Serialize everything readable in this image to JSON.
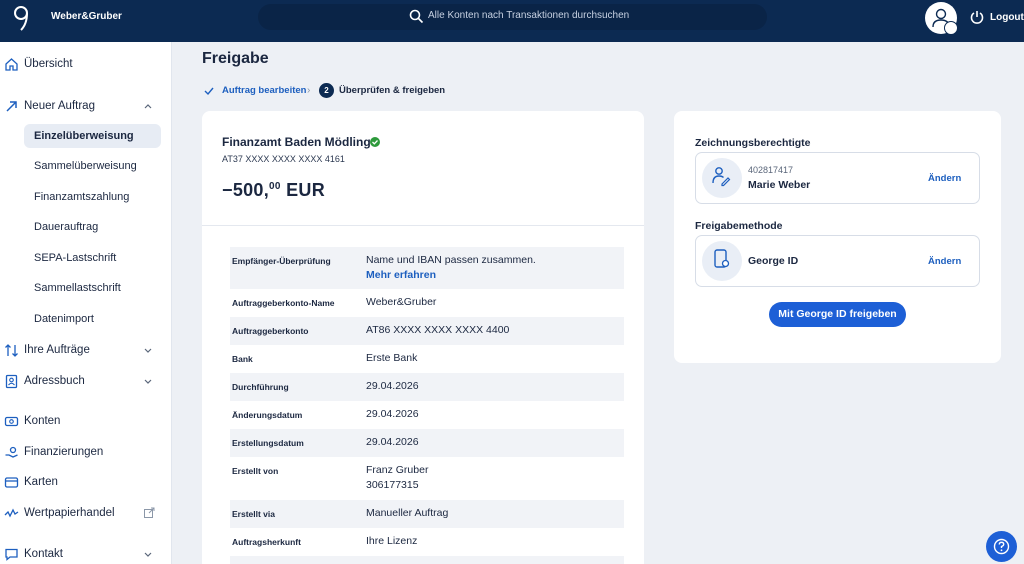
{
  "header": {
    "brand": "Weber&Gruber",
    "search_placeholder": "Alle Konten nach Transaktionen durchsuchen",
    "logout_label": "Logout"
  },
  "sidebar": {
    "items": [
      {
        "label": "Übersicht",
        "icon": "home-icon"
      },
      {
        "label": "Neuer Auftrag",
        "icon": "arrow-up-right-icon",
        "expanded": true
      },
      {
        "label": "Ihre Aufträge",
        "icon": "transfer-arrows-icon"
      },
      {
        "label": "Adressbuch",
        "icon": "address-book-icon"
      },
      {
        "label": "Konten",
        "icon": "accounts-icon"
      },
      {
        "label": "Finanzierungen",
        "icon": "financing-icon"
      },
      {
        "label": "Karten",
        "icon": "card-icon"
      },
      {
        "label": "Wertpapierhandel",
        "icon": "chart-icon"
      },
      {
        "label": "Kontakt",
        "icon": "chat-icon"
      }
    ],
    "subitems": [
      "Einzelüberweisung",
      "Sammelüberweisung",
      "Finanzamtszahlung",
      "Dauerauftrag",
      "SEPA-Lastschrift",
      "Sammellastschrift",
      "Datenimport"
    ],
    "active_subitem": "Einzelüberweisung"
  },
  "page": {
    "title": "Freigabe",
    "steps": [
      {
        "number": "1",
        "label": "Auftrag bearbeiten",
        "done": true
      },
      {
        "number": "2",
        "label": "Überprüfen & freigeben",
        "done": false
      }
    ]
  },
  "order": {
    "payee": "Finanzamt Baden Mödling",
    "iban": "AT37 XXXX XXXX XXXX 4161",
    "amount_sign": "−",
    "amount_main": "500,",
    "amount_decimals": "00",
    "currency": "EUR",
    "details": [
      {
        "label": "Empfänger-Überprüfung",
        "value": "Name und IBAN passen zusammen.",
        "link": "Mehr erfahren"
      },
      {
        "label": "Auftraggeberkonto-Name",
        "value": "Weber&Gruber"
      },
      {
        "label": "Auftraggeberkonto",
        "value": "AT86 XXXX XXXX XXXX 4400"
      },
      {
        "label": "Bank",
        "value": "Erste Bank"
      },
      {
        "label": "Durchführung",
        "value": "29.04.2026"
      },
      {
        "label": "Änderungsdatum",
        "value": "29.04.2026"
      },
      {
        "label": "Erstellungsdatum",
        "value": "29.04.2026"
      },
      {
        "label": "Erstellt von",
        "value": "Franz Gruber",
        "value2": "306177315"
      },
      {
        "label": "Erstellt via",
        "value": "Manueller Auftrag"
      },
      {
        "label": "Auftragsherkunft",
        "value": "Ihre Lizenz"
      }
    ]
  },
  "approval": {
    "signatory_title": "Zeichnungsberechtigte",
    "signatory_id": "402817417",
    "signatory_name": "Marie Weber",
    "signatory_action": "Ändern",
    "method_title": "Freigabemethode",
    "method_name": "George ID",
    "method_action": "Ändern",
    "submit_label": "Mit George ID freigeben"
  },
  "colors": {
    "header_bg": "#0c2a52",
    "primary": "#1d5fd6",
    "link": "#1d5fbf",
    "success": "#2e9a3c"
  }
}
